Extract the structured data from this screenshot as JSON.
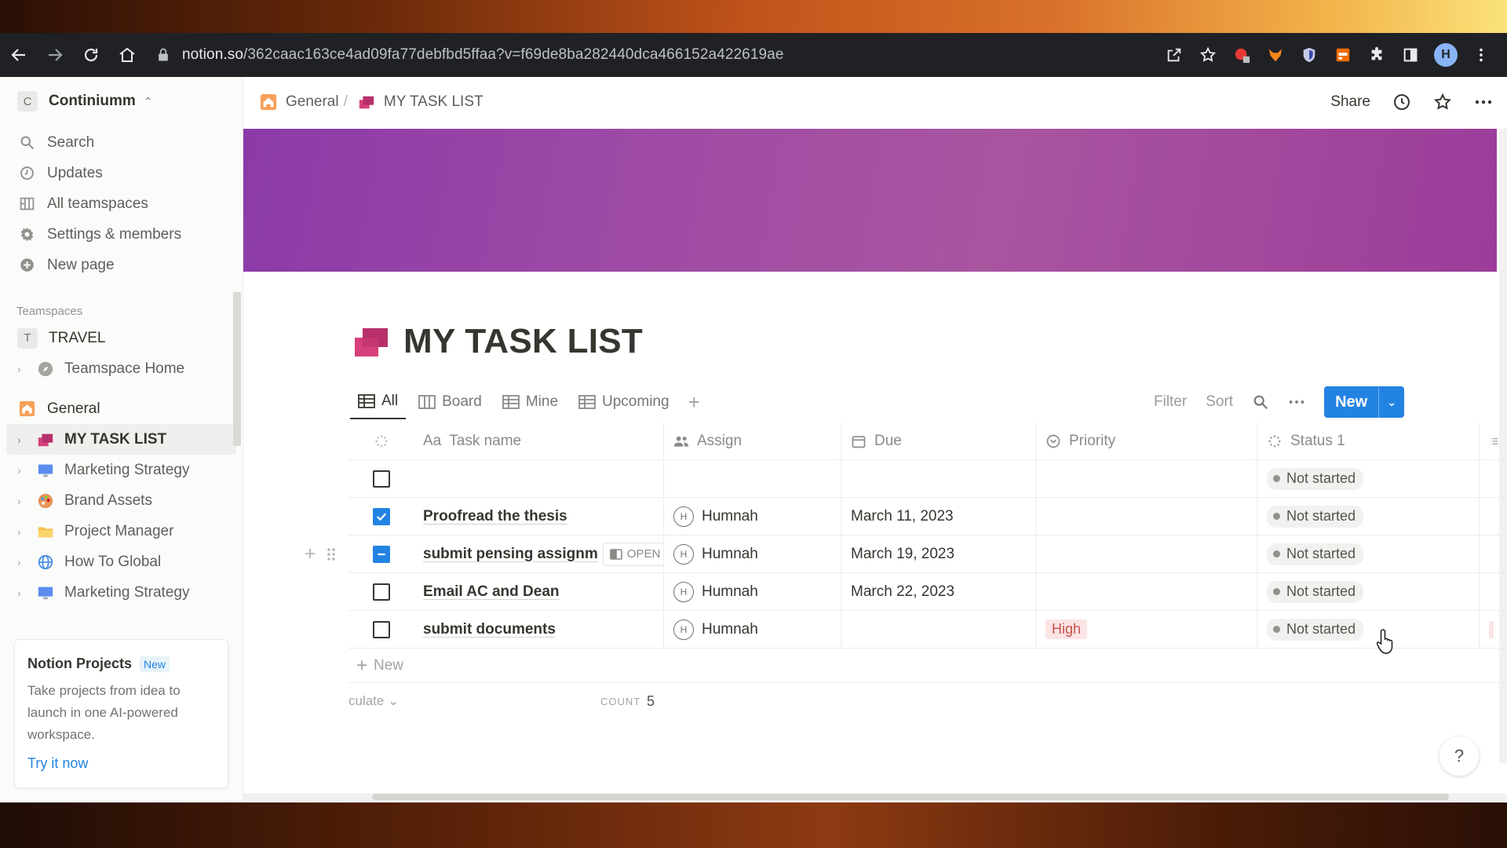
{
  "browser": {
    "url_host": "notion.so",
    "url_path": "/362caac163ce4ad09fa77debfbd5ffaa?v=f69de8ba282440dca466152a422619ae",
    "profile_initial": "H"
  },
  "sidebar": {
    "workspace_badge": "C",
    "workspace_name": "Continiumm",
    "nav": [
      {
        "label": "Search",
        "icon": "search-icon"
      },
      {
        "label": "Updates",
        "icon": "clock-icon"
      },
      {
        "label": "All teamspaces",
        "icon": "grid-icon"
      },
      {
        "label": "Settings & members",
        "icon": "gear-icon"
      },
      {
        "label": "New page",
        "icon": "plus-circle-icon"
      }
    ],
    "teamspaces_label": "Teamspaces",
    "travel_badge": "T",
    "travel_label": "TRAVEL",
    "teamspace_home": "Teamspace Home",
    "general_label": "General",
    "pages": [
      {
        "label": "MY TASK LIST",
        "icon": "task-list-icon"
      },
      {
        "label": "Marketing Strategy",
        "icon": "monitor-icon"
      },
      {
        "label": "Brand Assets",
        "icon": "palette-icon"
      },
      {
        "label": "Project Manager",
        "icon": "folder-icon"
      },
      {
        "label": "How To Global",
        "icon": "globe-icon"
      },
      {
        "label": "Marketing Strategy",
        "icon": "monitor-icon"
      }
    ],
    "promo": {
      "title": "Notion Projects",
      "badge": "New",
      "desc": "Take projects from idea to launch in one AI-powered workspace.",
      "cta": "Try it now"
    }
  },
  "topbar": {
    "crumb_parent": "General",
    "crumb_sep": "/",
    "crumb_current": "MY TASK LIST",
    "share": "Share"
  },
  "page": {
    "title": "MY TASK LIST",
    "views": [
      "All",
      "Board",
      "Mine",
      "Upcoming"
    ],
    "active_view": "All",
    "tools": {
      "filter": "Filter",
      "sort": "Sort",
      "new": "New"
    }
  },
  "table": {
    "columns": [
      "Task name",
      "Assign",
      "Due",
      "Priority",
      "Status 1"
    ],
    "column_type_aa": "Aa",
    "rows": [
      {
        "done": "unchecked",
        "task": "",
        "assign": "",
        "due": "",
        "priority": "",
        "status": "Not started"
      },
      {
        "done": "checked",
        "task": "Proofread the thesis",
        "assign": "Humnah",
        "due": "March 11, 2023",
        "priority": "",
        "status": "Not started"
      },
      {
        "done": "partial",
        "task": "submit pensing assignm",
        "assign": "Humnah",
        "due": "March 19, 2023",
        "priority": "",
        "status": "Not started",
        "open_label": "OPEN"
      },
      {
        "done": "unchecked",
        "task": "Email AC and Dean",
        "assign": "Humnah",
        "due": "March 22, 2023",
        "priority": "",
        "status": "Not started"
      },
      {
        "done": "unchecked",
        "task": "submit documents",
        "assign": "Humnah",
        "due": "",
        "priority": "High",
        "status": "Not started"
      }
    ],
    "avatar_initial": "H",
    "new_row": "New",
    "calculate": "culate",
    "count_label": "COUNT",
    "count_value": "5"
  },
  "help": "?"
}
